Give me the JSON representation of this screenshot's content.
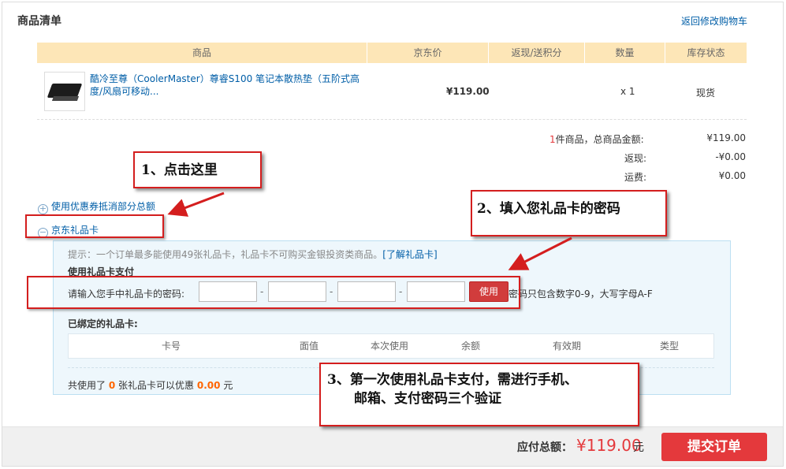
{
  "page": {
    "title": "商品清单",
    "back_link": "返回修改购物车"
  },
  "table": {
    "headers": [
      "商品",
      "京东价",
      "返现/送积分",
      "数量",
      "库存状态"
    ]
  },
  "product": {
    "name": "酷冷至尊（CoolerMaster）尊睿S100 笔记本散热垫（五阶式高度/风扇可移动...",
    "price": "¥119.00",
    "quantity": "x 1",
    "stock": "现货"
  },
  "summary": {
    "count": "1",
    "count_label": "件商品，总商品金额:",
    "total": "¥119.00",
    "cashback_label": "返现:",
    "cashback": "-¥0.00",
    "shipping_label": "运费:",
    "shipping": "¥0.00"
  },
  "coupon": {
    "toggle_icon": "plus-circle-icon",
    "label": "使用优惠券抵消部分总额"
  },
  "giftcard": {
    "toggle_icon": "minus-circle-icon",
    "label": "京东礼品卡",
    "tip": "提示：一个订单最多能使用49张礼品卡，礼品卡不可购买金银投资类商品。",
    "tip_link": "[了解礼品卡]",
    "pay_title": "使用礼品卡支付",
    "input_label": "请输入您手中礼品卡的密码:",
    "separator": "-",
    "use_button": "使用",
    "hint": "密码只包含数字0-9，大写字母A-F",
    "bound_title": "已绑定的礼品卡:",
    "bound_headers": [
      "卡号",
      "面值",
      "本次使用",
      "余额",
      "有效期",
      "类型"
    ],
    "used_prefix": "共使用了",
    "used_count": "0",
    "used_mid": "张礼品卡可以优惠",
    "used_amount": "0.00",
    "used_suffix": "元"
  },
  "footer": {
    "total_label": "应付总额：",
    "total_amount": "¥119.00",
    "total_unit": "元",
    "submit_button": "提交订单"
  },
  "annotations": {
    "step1": "1、点击这里",
    "step2": "2、填入您礼品卡的密码",
    "step3_line1": "3、第一次使用礼品卡支付，需进行手机、",
    "step3_line2": "邮箱、支付密码三个验证"
  },
  "colors": {
    "accent_red": "#e4393c",
    "link_blue": "#005ea7",
    "table_header": "#fde6b7",
    "giftbox_bg": "#eef7fc",
    "annotation_red": "#d41e1e"
  }
}
